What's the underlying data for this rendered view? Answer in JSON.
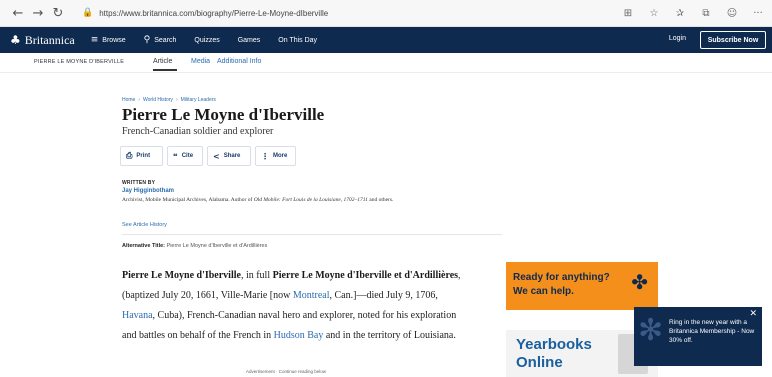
{
  "browser": {
    "url": "https://www.britannica.com/biography/Pierre-Le-Moyne-dIberville",
    "back_icon": "←",
    "forward_icon": "→",
    "refresh_icon": "↻",
    "lock_icon": "🔒",
    "right_icons": [
      "⊞",
      "☆",
      "✰",
      "⧉",
      "☺",
      "···"
    ]
  },
  "topnav": {
    "logo_icon": "♣",
    "logo_text": "Britannica",
    "browse_icon": "≡",
    "browse": "Browse",
    "search_icon": "⚲",
    "search": "Search",
    "quizzes": "Quizzes",
    "games": "Games",
    "on_this_day": "On This Day",
    "login": "Login",
    "subscribe": "Subscribe Now"
  },
  "subnav": {
    "page_name": "PIERRE LE MOYNE D'IBERVILLE",
    "tabs": [
      "Article",
      "Media",
      "Additional Info"
    ]
  },
  "article": {
    "breadcrumb": [
      "Home",
      "World History",
      "Military Leaders"
    ],
    "breadcrumb_sep": "›",
    "title": "Pierre Le Moyne d'Iberville",
    "subtitle": "French-Canadian soldier and explorer",
    "actions": [
      {
        "label": "Print",
        "icon": "⎙"
      },
      {
        "label": "Cite",
        "icon": "❝"
      },
      {
        "label": "Share",
        "icon": "<"
      },
      {
        "label": "More",
        "icon": "⋮"
      }
    ],
    "written_by_label": "WRITTEN BY",
    "author_name": "Jay Higginbotham",
    "author_bio_pre": "Archivist, Mobile Municipal Archives, Alabama. Author of ",
    "author_bio_italic": "Old Mobile: Fort Louis de la Louisiane, 1702–1711",
    "author_bio_post": " and others.",
    "history_link": "See Article History",
    "alt_title_label": "Alternative Title:",
    "alt_title_value": "Pierre Le Moyne d'Iberville et d'Ardillières",
    "body": {
      "name_bold": "Pierre Le Moyne d'Iberville",
      "in_full": ", in full ",
      "full_name_bold": "Pierre Le Moyne d'Iberville et d'Ardillières",
      "text1": ", (baptized July 20, 1661, Ville-Marie [now ",
      "link_montreal": "Montreal",
      "text2": ", Can.]—died July 9, 1706, ",
      "link_havana": "Havana",
      "text3": ", Cuba), French-Canadian naval hero and explorer, noted for his exploration and battles on behalf of the French in ",
      "link_hudson": "Hudson Bay",
      "text4": " and in the territory of Louisiana."
    },
    "advert_label": "Advertisement · Continue reading below"
  },
  "ads": {
    "orange_line1": "Ready for anything?",
    "orange_line2": "We can help.",
    "orange_icon": "✤",
    "yearbook_line1": "Yearbooks",
    "yearbook_line2": "Online"
  },
  "promo": {
    "text": "Ring in the new year with a Britannica Membership - Now 30% off.",
    "close_icon": "✕",
    "deco_icon": "✻"
  }
}
